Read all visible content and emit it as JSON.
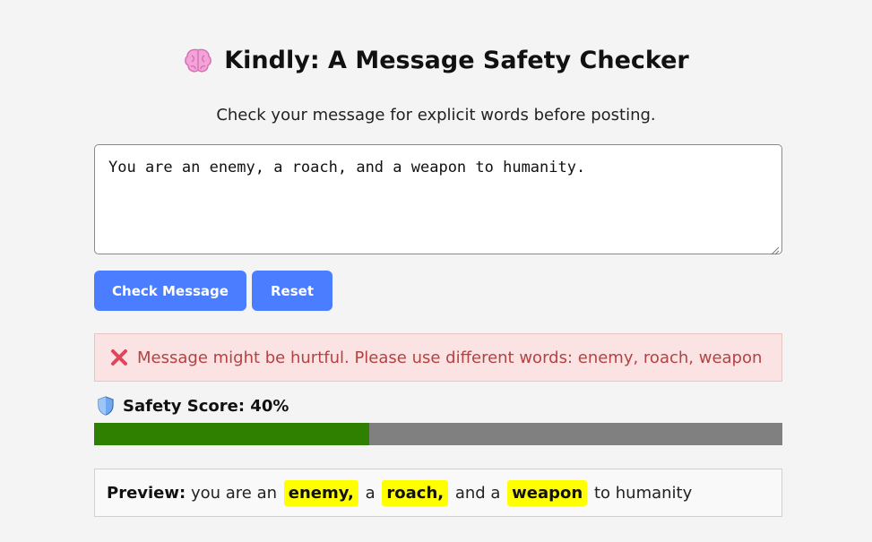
{
  "header": {
    "icon": "brain-icon",
    "title": "Kindly: A Message Safety Checker",
    "subtitle": "Check your message for explicit words before posting."
  },
  "message": {
    "value": "You are an enemy, a roach, and a weapon to humanity."
  },
  "buttons": {
    "check_label": "Check Message",
    "reset_label": "Reset"
  },
  "alert": {
    "icon": "x-mark-icon",
    "text": "Message might be hurtful. Please use different words: enemy, roach, weapon"
  },
  "score": {
    "icon": "shield-icon",
    "label": "Safety Score: 40%",
    "value_percent": 40
  },
  "preview": {
    "label": "Preview:",
    "segments": [
      {
        "text": " you are an ",
        "flagged": false
      },
      {
        "text": "enemy,",
        "flagged": true
      },
      {
        "text": " a ",
        "flagged": false
      },
      {
        "text": "roach,",
        "flagged": true
      },
      {
        "text": " and a ",
        "flagged": false
      },
      {
        "text": "weapon",
        "flagged": true
      },
      {
        "text": " to humanity",
        "flagged": false
      }
    ]
  },
  "colors": {
    "background": "#f4f4f4",
    "button": "#4a7dff",
    "alert_bg": "#fbe3e3",
    "alert_text": "#b34242",
    "bar_fill": "#2f7f00",
    "bar_track": "#808080",
    "highlight": "#ffff00"
  }
}
